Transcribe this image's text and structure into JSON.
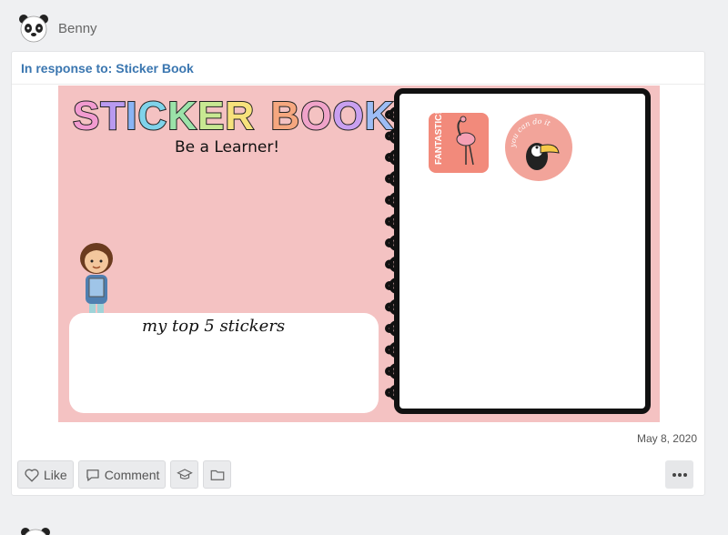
{
  "author": {
    "name": "Benny",
    "avatar": "panda-avatar-icon"
  },
  "response": {
    "prefix": "In response to:",
    "title": "Sticker Book"
  },
  "artwork": {
    "title_letters": [
      "S",
      "T",
      "I",
      "C",
      "K",
      "E",
      "R",
      " ",
      "B",
      "O",
      "O",
      "K"
    ],
    "title_colors": [
      "#f29bd0",
      "#b99af0",
      "#8ab4f5",
      "#7fd3ea",
      "#9be3a9",
      "#c8e892",
      "#f7e27c",
      "#f9c978",
      "#f6a77f",
      "#f0a3c9",
      "#c9a0f0",
      "#9dbdf5"
    ],
    "subtitle": "Be a Learner!",
    "panel_label": "my top 5 stickers",
    "sticker1_text": "FANTASTIC!",
    "sticker2_text": "you can do it"
  },
  "date": "May 8, 2020",
  "actions": {
    "like": "Like",
    "comment": "Comment"
  }
}
